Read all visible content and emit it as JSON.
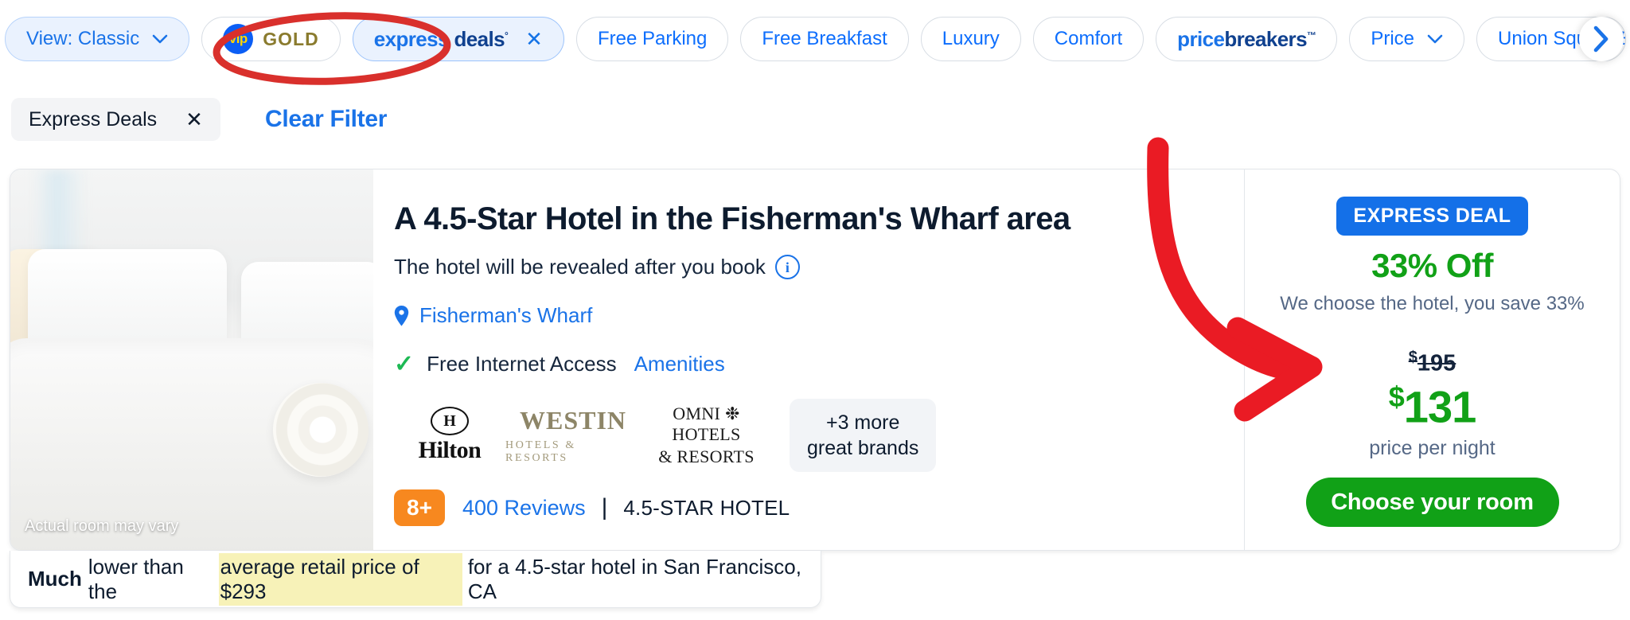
{
  "filter_bar": {
    "pills": [
      {
        "id": "view-classic",
        "label": "View: Classic",
        "icon": "chevron-down-icon"
      },
      {
        "id": "vip-gold",
        "label": "GOLD",
        "icon": "vip-icon",
        "badge_text": "vip"
      },
      {
        "id": "express-deals",
        "label": "express deals",
        "label_part1": "express",
        "label_part2": "deals",
        "trademark": "°",
        "close": "✕"
      },
      {
        "id": "free-parking",
        "label": "Free Parking"
      },
      {
        "id": "free-breakfast",
        "label": "Free Breakfast"
      },
      {
        "id": "luxury",
        "label": "Luxury"
      },
      {
        "id": "comfort",
        "label": "Comfort"
      },
      {
        "id": "pricebreakers",
        "label": "pricebreakers",
        "label_part1": "price",
        "label_part2": "breakers",
        "trademark": "™"
      },
      {
        "id": "price",
        "label": "Price",
        "icon": "chevron-down-icon"
      },
      {
        "id": "union-square",
        "label": "Union Square Ea"
      }
    ],
    "next_label": "›"
  },
  "applied_filters": {
    "chip_label": "Express Deals",
    "chip_close": "✕",
    "clear_label": "Clear Filter"
  },
  "hotel_card": {
    "photo_caption": "Actual room may vary",
    "title": "A 4.5-Star Hotel in the Fisherman's Wharf area",
    "reveal_text": "The hotel will be revealed after you book",
    "info_glyph": "i",
    "location": "Fisherman's Wharf",
    "check_glyph": "✓",
    "amenity_text": "Free Internet Access",
    "amenities_link": "Amenities",
    "brands": [
      {
        "name": "Hilton",
        "mark": "H",
        "word": "Hilton",
        "sub": ""
      },
      {
        "name": "Westin",
        "word": "WESTIN",
        "sub": "HOTELS & RESORTS",
        "tm": "®"
      },
      {
        "name": "Omni Hotels & Resorts",
        "line1": "OMNI ❉ HOTELS",
        "line2": "& RESORTS"
      }
    ],
    "more_brands_line1": "+3 more",
    "more_brands_line2": "great brands",
    "score": "8+",
    "reviews": "400 Reviews",
    "separator": "|",
    "star_class": "4.5-STAR HOTEL"
  },
  "price_panel": {
    "badge": "EXPRESS DEAL",
    "percent_off": "33% Off",
    "subtitle": "We choose the hotel, you save 33%",
    "strike_currency": "$",
    "strike_price": "195",
    "currency": "$",
    "price": "131",
    "per_night": "price per night",
    "cta": "Choose your room"
  },
  "bottom_banner": {
    "bold_prefix": "Much",
    "text_before": "lower than the",
    "highlight": "average retail price of $293",
    "text_after": "for a 4.5-star hotel in San Francisco, CA"
  },
  "colors": {
    "brand_blue": "#1a73e8",
    "deal_green": "#11a117",
    "score_orange": "#f7881f",
    "annotation_red": "#e02020",
    "highlight_yellow": "#f7f2b8"
  }
}
